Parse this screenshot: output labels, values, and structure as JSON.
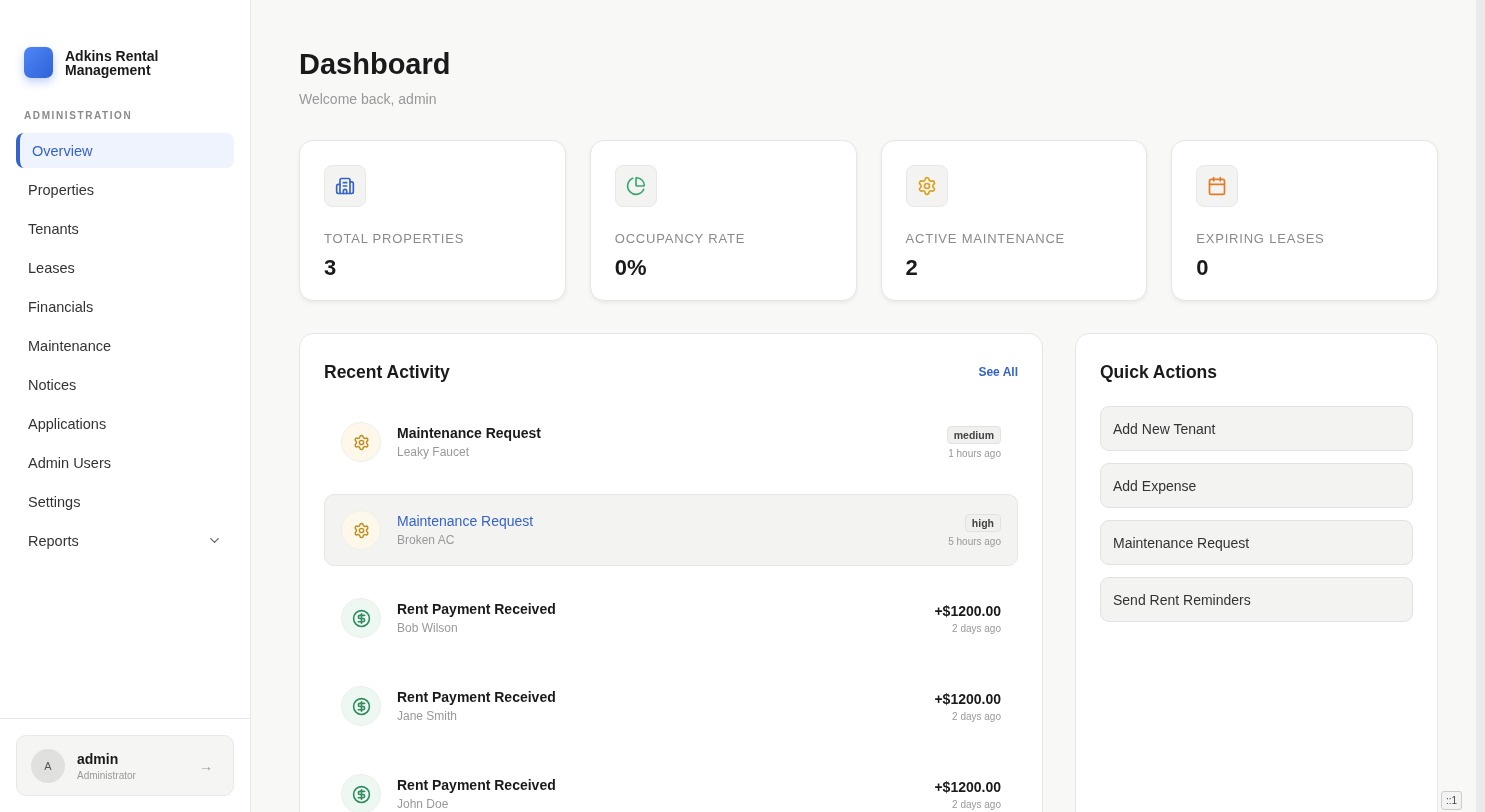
{
  "brand": {
    "name": "Adkins Rental Management"
  },
  "sidebar": {
    "section": "ADMINISTRATION",
    "items": [
      {
        "label": "Overview",
        "selected": true
      },
      {
        "label": "Properties",
        "selected": false
      },
      {
        "label": "Tenants",
        "selected": false
      },
      {
        "label": "Leases",
        "selected": false
      },
      {
        "label": "Financials",
        "selected": false
      },
      {
        "label": "Maintenance",
        "selected": false
      },
      {
        "label": "Notices",
        "selected": false
      },
      {
        "label": "Applications",
        "selected": false
      },
      {
        "label": "Admin Users",
        "selected": false
      },
      {
        "label": "Settings",
        "selected": false
      },
      {
        "label": "Reports",
        "selected": false,
        "expanded": false
      }
    ]
  },
  "user": {
    "initial": "A",
    "name": "admin",
    "role": "Administrator",
    "action": "→"
  },
  "header": {
    "title": "Dashboard",
    "subtitle": "Welcome back, admin"
  },
  "stats": [
    {
      "kind": "properties",
      "label": "TOTAL PROPERTIES",
      "value": "3"
    },
    {
      "kind": "occupancy",
      "label": "OCCUPANCY RATE",
      "value": "0%"
    },
    {
      "kind": "maintenance",
      "label": "ACTIVE MAINTENANCE",
      "value": "2"
    },
    {
      "kind": "leases",
      "label": "EXPIRING LEASES",
      "value": "0"
    }
  ],
  "activity": {
    "title": "Recent Activity",
    "link": "See All",
    "items": [
      {
        "kind": "maintenance",
        "title": "Maintenance Request",
        "subtitle": "Leaky Faucet",
        "badge": "medium",
        "time": "1 hours ago",
        "selected": false
      },
      {
        "kind": "maintenance",
        "title": "Maintenance Request",
        "subtitle": "Broken AC",
        "badge": "high",
        "time": "5 hours ago",
        "selected": true
      },
      {
        "kind": "payment",
        "title": "Rent Payment Received",
        "subtitle": "Bob Wilson",
        "amount": "+$1200.00",
        "time": "2 days ago",
        "selected": false
      },
      {
        "kind": "payment",
        "title": "Rent Payment Received",
        "subtitle": "Jane Smith",
        "amount": "+$1200.00",
        "time": "2 days ago",
        "selected": false
      },
      {
        "kind": "payment",
        "title": "Rent Payment Received",
        "subtitle": "John Doe",
        "amount": "+$1200.00",
        "time": "2 days ago",
        "selected": false
      }
    ]
  },
  "quick_actions": {
    "title": "Quick Actions",
    "buttons": [
      "Add New Tenant",
      "Add Expense",
      "Maintenance Request",
      "Send Rent Reminders"
    ]
  },
  "corner_badge": "::1"
}
